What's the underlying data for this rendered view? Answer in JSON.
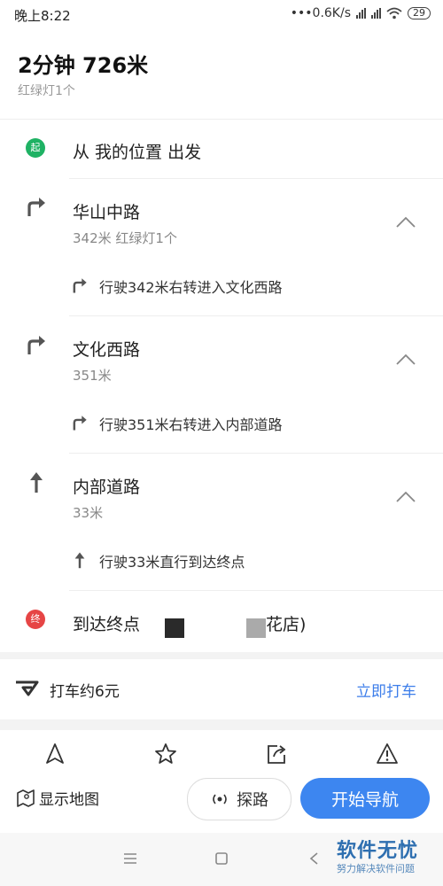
{
  "status_bar": {
    "time": "晚上8:22",
    "speed": "0.6K/s",
    "battery": "29"
  },
  "summary": {
    "title": "2分钟  726米",
    "traffic_lights": "红绿灯1个"
  },
  "start": {
    "badge": "起",
    "text": "从  我的位置  出发",
    "badge_color": "#1fb264"
  },
  "steps": [
    {
      "road": "华山中路",
      "meta": "342米  红绿灯1个",
      "detail": "行驶342米右转进入文化西路",
      "turn_icon": "turn-right-icon"
    },
    {
      "road": "文化西路",
      "meta": "351米",
      "detail": "行驶351米右转进入内部道路",
      "turn_icon": "turn-right-icon"
    },
    {
      "road": "内部道路",
      "meta": "33米",
      "detail": "行驶33米直行到达终点",
      "turn_icon": "straight-icon"
    }
  ],
  "end": {
    "badge": "终",
    "text": "到达终点",
    "text_tail": "花店)",
    "badge_color": "#e64545"
  },
  "taxi": {
    "label": "打车约6元",
    "button": "立即打车"
  },
  "toolbar": {
    "icons": [
      "navigate-icon",
      "star-icon",
      "share-icon",
      "warning-icon"
    ]
  },
  "actions": {
    "show_map": "显示地图",
    "probe": "探路",
    "start_nav": "开始导航"
  },
  "watermark": {
    "title": "软件无忧",
    "subtitle": "努力解决软件问题"
  },
  "colors": {
    "accent": "#3d86f0",
    "link": "#3d7eea"
  }
}
